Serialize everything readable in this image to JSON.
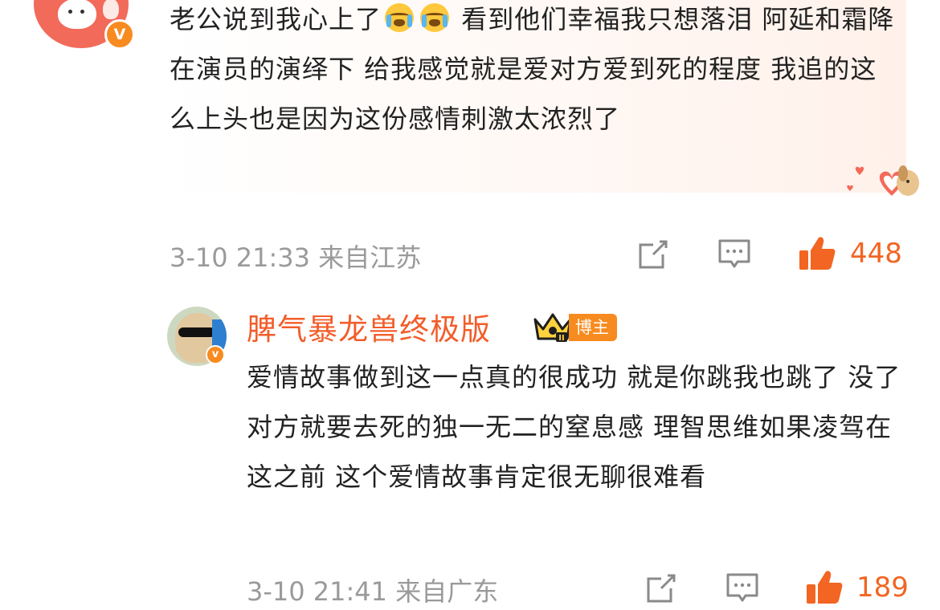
{
  "comment1": {
    "text_before_emoji": "老公说到我心上了",
    "text_after_emoji": " 看到他们幸福我只想落泪 阿延和霜降在演员的演绎下 给我感觉就是爱对方爱到死的程度 我追的这么上头也是因为这份感情刺激太浓烈了",
    "emoji_icons": [
      "loudly-crying-face-icon",
      "loudly-crying-face-icon"
    ],
    "meta": "3-10 21:33 来自江苏",
    "like_count": "448",
    "verified_badge": "V"
  },
  "comment2": {
    "username": "脾气暴龙兽终极版",
    "badge_label": "博主",
    "text": "爱情故事做到这一点真的很成功 就是你跳我也跳了 没了对方就要去死的独一无二的窒息感 理智思维如果凌驾在这之前 这个爱情故事肯定很无聊很难看",
    "meta": "3-10 21:41 来自广东",
    "like_count": "189",
    "verified_badge": "v",
    "level_badge": "II"
  },
  "colors": {
    "accent_orange": "#f26522",
    "username_red": "#f25d2a",
    "meta_gray": "#9a9a9a",
    "text": "#222222",
    "badge_orange": "#f78b1f"
  },
  "icons": {
    "share": "share-icon",
    "comment": "comment-icon",
    "like": "thumbs-up-icon"
  }
}
